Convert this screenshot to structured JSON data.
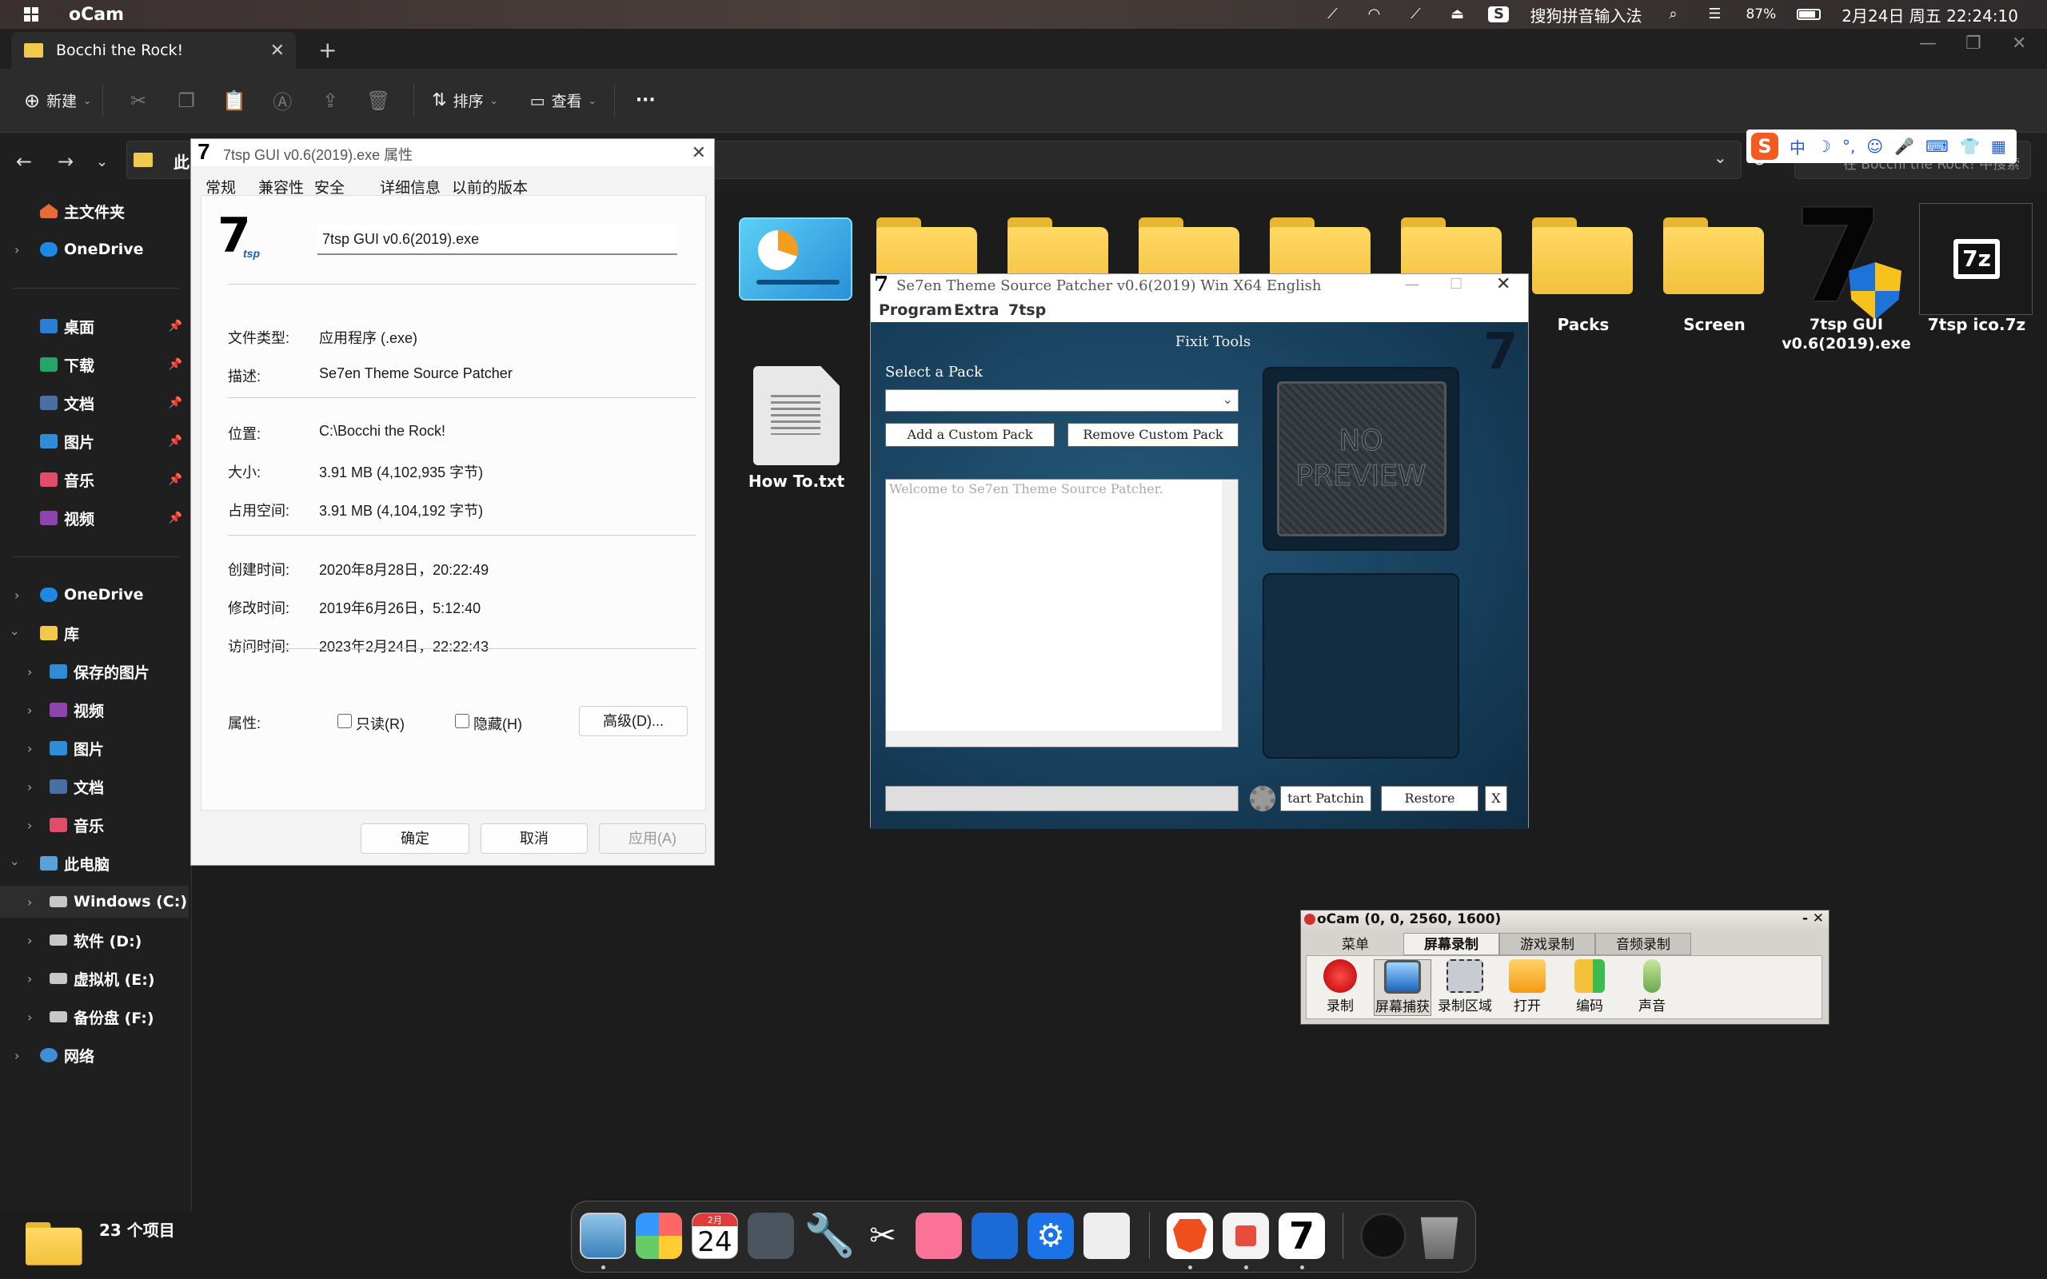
{
  "menubar": {
    "app": "oCam",
    "ime_name": "搜狗拼音输入法",
    "battery": "87%",
    "datetime": "2月24日 周五 22:24:10"
  },
  "explorer": {
    "tab_title": "Bocchi the Rock!",
    "toolbar": {
      "new": "新建",
      "sort": "排序",
      "view": "查看",
      "more": "···"
    },
    "address_partial": "此",
    "search_placeholder": "在 Bocchi the Rock! 中搜索",
    "sidebar": {
      "home": "主文件夹",
      "onedrive1": "OneDrive",
      "quick": [
        "桌面",
        "下载",
        "文档",
        "图片",
        "音乐",
        "视频"
      ],
      "onedrive2": "OneDrive",
      "library": "库",
      "lib_items": [
        "保存的图片",
        "视频",
        "图片",
        "文档",
        "音乐"
      ],
      "thispc": "此电脑",
      "drives": [
        "Windows (C:)",
        "软件 (D:)",
        "虚拟机 (E:)",
        "备份盘 (F:)"
      ],
      "network": "网络"
    },
    "items": {
      "packs": "Packs",
      "screen": "Screen",
      "exe": "7tsp GUI\nv0.6(2019).exe",
      "zip": "7tsp ico.7z",
      "txt": "How To.txt",
      "zip_icon_text": "7z"
    },
    "status": "23 个项目"
  },
  "props": {
    "title": "7tsp GUI v0.6(2019).exe 属性",
    "tabs": [
      "常规",
      "兼容性",
      "安全",
      "详细信息",
      "以前的版本"
    ],
    "filename": "7tsp GUI v0.6(2019).exe",
    "rows": [
      {
        "k": "文件类型:",
        "v": "应用程序 (.exe)"
      },
      {
        "k": "描述:",
        "v": "Se7en Theme Source Patcher"
      },
      {
        "k": "位置:",
        "v": "C:\\Bocchi the Rock!"
      },
      {
        "k": "大小:",
        "v": "3.91 MB (4,102,935 字节)"
      },
      {
        "k": "占用空间:",
        "v": "3.91 MB (4,104,192 字节)"
      },
      {
        "k": "创建时间:",
        "v": "2020年8月28日，20:22:49"
      },
      {
        "k": "修改时间:",
        "v": "2019年6月26日，5:12:40"
      },
      {
        "k": "访问时间:",
        "v": "2023年2月24日，22:22:43"
      }
    ],
    "attr_label": "属性:",
    "readonly": "只读(R)",
    "hidden": "隐藏(H)",
    "advanced": "高级(D)...",
    "ok": "确定",
    "cancel": "取消",
    "apply": "应用(A)"
  },
  "patcher": {
    "title": "Se7en Theme Source Patcher v0.6(2019) Win X64 English",
    "menu": [
      "Program",
      "Extra",
      "7tsp"
    ],
    "section": "Fixit Tools",
    "select_pack": "Select a Pack",
    "add": "Add a Custom Pack",
    "remove": "Remove Custom Pack",
    "log": "Welcome to Se7en Theme Source Patcher.",
    "no_preview": [
      "NO",
      "PREVIEW"
    ],
    "start": "tart Patchin",
    "restore": "Restore",
    "close": "X"
  },
  "ocam": {
    "title": "oCam (0, 0, 2560, 1600)",
    "tabs": [
      "菜单",
      "屏幕录制",
      "游戏录制",
      "音频录制"
    ],
    "buttons": [
      "录制",
      "屏幕捕获",
      "录制区域",
      "打开",
      "编码",
      "声音"
    ]
  },
  "dock": {
    "calendar_month": "2月",
    "calendar_day": "24"
  },
  "ime": [
    "中",
    "☽",
    "°,",
    "☺",
    "🎤",
    "⌨",
    "👕",
    "▦"
  ],
  "colors": {
    "folder": "#f3c13c",
    "accent": "#0a5ad4"
  }
}
